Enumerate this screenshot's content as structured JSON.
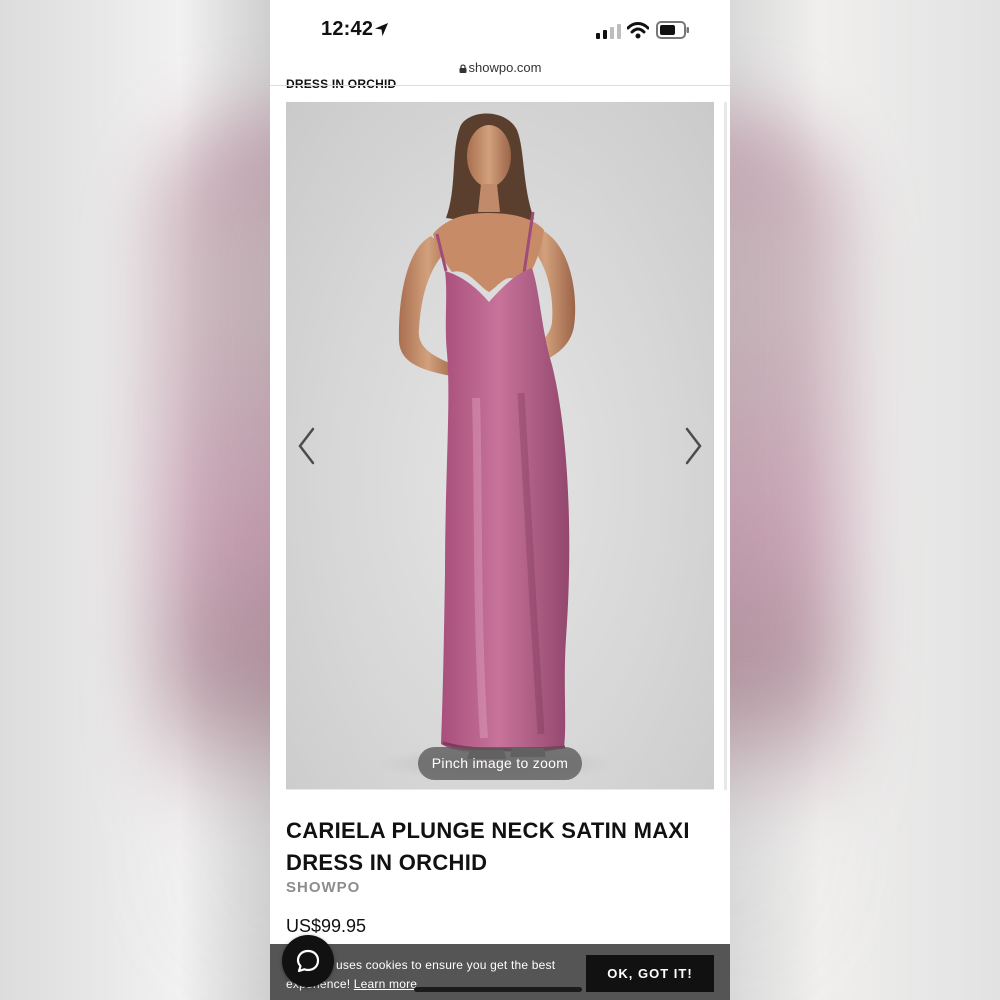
{
  "status_bar": {
    "time": "12:42",
    "icons": [
      "location-arrow-icon",
      "cellular-signal-icon",
      "wifi-icon",
      "battery-icon"
    ]
  },
  "browser": {
    "url": "showpo.com",
    "lock_icon": "lock-icon"
  },
  "header": {
    "scrolled_title": "DRESS IN ORCHID"
  },
  "gallery": {
    "previous_icon": "chevron-left-icon",
    "next_icon": "chevron-right-icon",
    "zoom_hint": "Pinch image to zoom",
    "dress_color": "#b35b86"
  },
  "product": {
    "title": "CARIELA PLUNGE NECK SATIN MAXI DRESS IN ORCHID",
    "brand": "SHOWPO",
    "price": "US$99.95"
  },
  "cookie_banner": {
    "message_start": "uses cookies to ensure you get the best",
    "message_continued": "experience!",
    "learn_more_label": "Learn more",
    "accept_label": "OK, GOT IT!"
  },
  "chat": {
    "icon": "chat-bubble-icon"
  },
  "colors": {
    "background": "#ffffff",
    "text": "#111111",
    "brand_text": "#8d8d8d",
    "cookie_banner": "#555555",
    "button": "#111111"
  }
}
